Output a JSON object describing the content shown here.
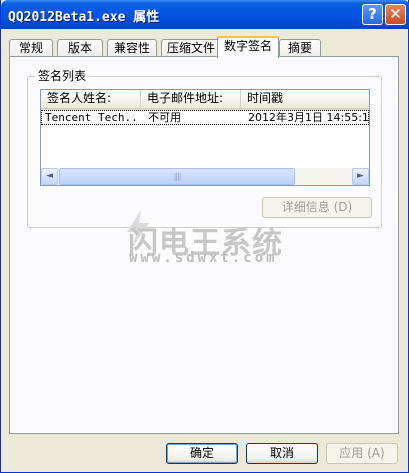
{
  "window": {
    "title": "QQ2012Beta1.exe 属性",
    "help_label": "?",
    "close_label": "✕"
  },
  "tabs": [
    {
      "label": "常规",
      "active": false
    },
    {
      "label": "版本",
      "active": false
    },
    {
      "label": "兼容性",
      "active": false
    },
    {
      "label": "压缩文件",
      "active": false
    },
    {
      "label": "数字签名",
      "active": true
    },
    {
      "label": "摘要",
      "active": false
    }
  ],
  "signature_group": {
    "title": "签名列表",
    "columns": [
      "签名人姓名:",
      "电子邮件地址:",
      "时间戳"
    ],
    "rows": [
      {
        "signer": "Tencent Tech...",
        "email": "不可用",
        "timestamp": "2012年3月1日 14:55:1"
      }
    ],
    "scroll_left": "◄",
    "scroll_right": "►",
    "scroll_grip": "||||"
  },
  "details_button": "详细信息 (D)",
  "watermark": {
    "text": "闪电王系统",
    "url": "www.sdwxt.com"
  },
  "footer": {
    "ok": "确定",
    "cancel": "取消",
    "apply": "应用 (A)"
  },
  "colors": {
    "title_bar": "#0554e3",
    "active_tab_accent": "#ffc83c",
    "button_border": "#003c74"
  }
}
